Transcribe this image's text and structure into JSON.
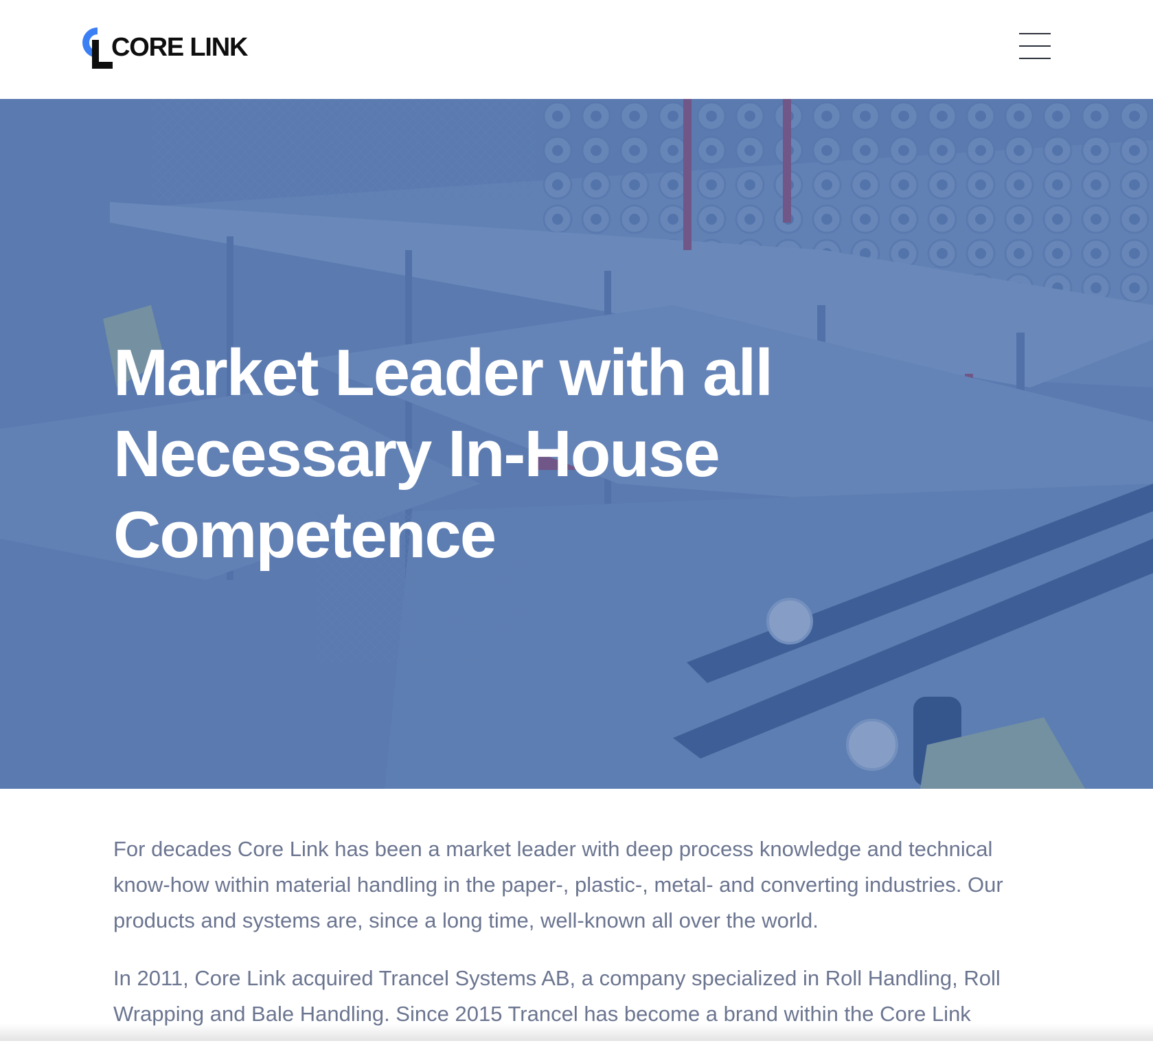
{
  "header": {
    "logo_text": "CORE LINK",
    "menu_icon": "hamburger-menu-icon"
  },
  "hero": {
    "title": "Market Leader with all Necessary In-House Competence",
    "background_description_icon": "industrial-roll-handling-plant-image"
  },
  "content": {
    "paragraphs": [
      "For decades Core Link has been a market leader with deep process knowledge and technical know-how within material handling in the paper-, plastic-, metal- and converting industries. Our products and systems are, since a long time, well-known all over the world.",
      "In 2011, Core Link acquired Trancel Systems AB, a company specialized in Roll Handling, Roll Wrapping and Bale Handling. Since 2015 Trancel has become a brand within the Core Link"
    ]
  },
  "colors": {
    "brand_blue": "#3b7ff5",
    "hero_overlay": "#4a6ea6",
    "text_dark": "#0e0e0e",
    "body_text": "#6b7590"
  }
}
